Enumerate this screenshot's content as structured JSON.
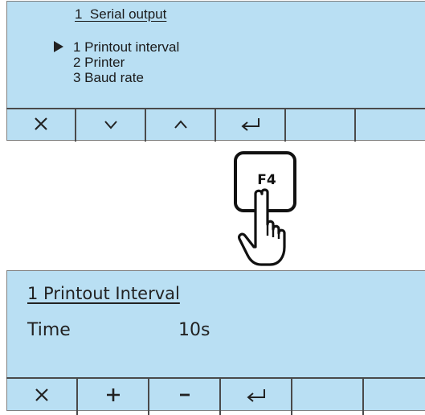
{
  "screen1": {
    "title": "1  Serial output",
    "menu_items": [
      {
        "label": "1 Printout interval",
        "selected": true
      },
      {
        "label": "2 Printer",
        "selected": false
      },
      {
        "label": "3 Baud rate",
        "selected": false
      }
    ],
    "softkeys": [
      {
        "glyph": "×",
        "icon": "close-icon"
      },
      {
        "glyph": "∨",
        "icon": "chevron-down-icon"
      },
      {
        "glyph": "∧",
        "icon": "chevron-up-icon"
      },
      {
        "glyph": "↵",
        "icon": "enter-icon"
      },
      {
        "glyph": "",
        "icon": ""
      },
      {
        "glyph": "",
        "icon": ""
      }
    ]
  },
  "key": {
    "label": "F4",
    "icon": "pointing-hand-icon"
  },
  "screen2": {
    "title": "1 Printout Interval",
    "param_label": "Time",
    "param_value": "10s",
    "softkeys": [
      {
        "glyph": "×",
        "icon": "close-icon"
      },
      {
        "glyph": "+",
        "icon": "plus-icon"
      },
      {
        "glyph": "-",
        "icon": "minus-icon"
      },
      {
        "glyph": "↵",
        "icon": "enter-icon"
      },
      {
        "glyph": "",
        "icon": ""
      },
      {
        "glyph": "",
        "icon": ""
      }
    ]
  },
  "colors": {
    "screen_bg": "#b9dff3",
    "text": "#222222",
    "border": "#4a4a4a"
  }
}
